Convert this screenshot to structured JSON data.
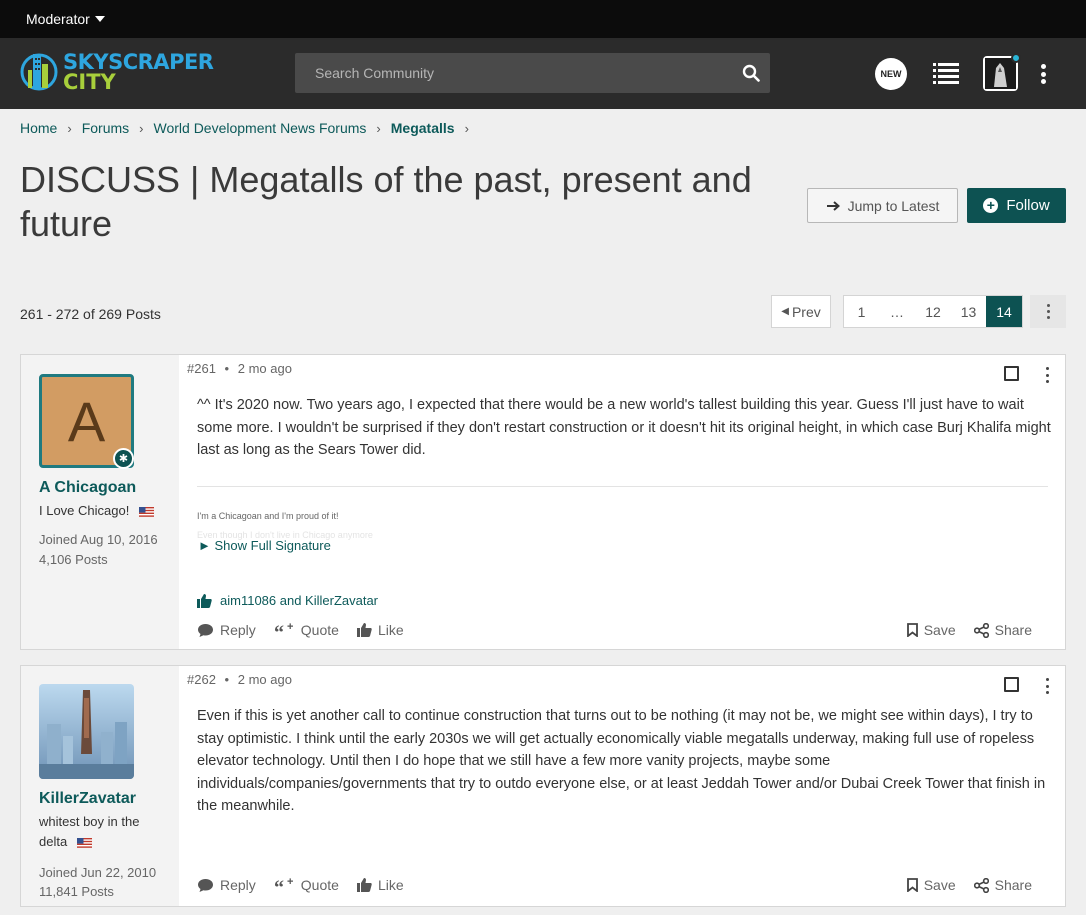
{
  "modbar": {
    "label": "Moderator"
  },
  "header": {
    "logo_line1": "SKYSCRAPER",
    "logo_line2": "CITY",
    "search_placeholder": "Search Community",
    "new_badge": "NEW"
  },
  "breadcrumb": [
    "Home",
    "Forums",
    "World Development News Forums",
    "Megatalls"
  ],
  "thread": {
    "title": "DISCUSS | Megatalls of the past, present and future",
    "jump_label": "Jump to Latest",
    "follow_label": "Follow",
    "post_count": "261 - 272 of 269 Posts"
  },
  "pagination": {
    "prev": "Prev",
    "pages": [
      "1",
      "…",
      "12",
      "13",
      "14"
    ],
    "active": "14"
  },
  "posts": [
    {
      "number": "#261",
      "time": "2 mo ago",
      "author": "A Chicagoan",
      "avatar_letter": "A",
      "user_title": "I Love Chicago!",
      "joined": "Joined Aug 10, 2016",
      "post_count": "4,106 Posts",
      "body": "^^ It's 2020 now. Two years ago, I expected that there would be a new world's tallest building this year. Guess I'll just have to wait some more. I wouldn't be surprised if they don't restart construction or it doesn't hit its original height, in which case Burj Khalifa might last as long as the Sears Tower did.",
      "signature_line1": "I'm a Chicagoan and I'm proud of it!",
      "signature_line2": "Even though I don't live in Chicago anymore",
      "signature_toggle": "Show Full Signature",
      "likes": "aim11086 and KillerZavatar",
      "actions": {
        "reply": "Reply",
        "quote": "Quote",
        "like": "Like",
        "save": "Save",
        "share": "Share"
      }
    },
    {
      "number": "#262",
      "time": "2 mo ago",
      "author": "KillerZavatar",
      "user_title": "whitest boy in the delta",
      "joined": "Joined Jun 22, 2010",
      "post_count": "11,841 Posts",
      "body": "Even if this is yet another call to continue construction that turns out to be nothing (it may not be, we might see within days), I try to stay optimistic. I think until the early 2030s we will get actually economically viable megatalls underway, making full use of ropeless elevator technology. Until then I do hope that we still have a few more vanity projects, maybe some individuals/companies/governments that try to outdo everyone else, or at least Jeddah Tower and/or Dubai Creek Tower that finish in the meanwhile.",
      "actions": {
        "reply": "Reply",
        "quote": "Quote",
        "like": "Like",
        "save": "Save",
        "share": "Share"
      }
    }
  ],
  "colors": {
    "accent": "#0d5252",
    "link": "#0d5a5a",
    "header_bg": "#2b2b2b"
  }
}
